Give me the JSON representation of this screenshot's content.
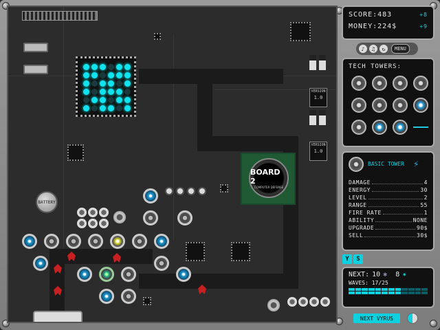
{
  "hud": {
    "score_label": "SCORE:",
    "score_value": "483",
    "score_delta": "+8",
    "money_label": "MONEY:",
    "money_value": "224$",
    "money_delta": "+9"
  },
  "toolbar": {
    "sound_icon": "speaker-icon",
    "music_icon": "music-note-icon",
    "restart_icon": "refresh-icon",
    "menu_label": "MENU"
  },
  "towers": {
    "title": "TECH TOWERS:",
    "items": [
      "tower-basic",
      "tower-drum",
      "tower-cage",
      "tower-coil",
      "tower-ring",
      "tower-cross",
      "tower-box",
      "tower-lens",
      "tower-cannon",
      "tower-blue-gear",
      "tower-blue-star",
      "tower-beam"
    ]
  },
  "info": {
    "name": "BASIC TOWER",
    "stats": [
      {
        "label": "DAMAGE",
        "value": "4"
      },
      {
        "label": "ENERGY",
        "value": "30"
      },
      {
        "label": "LEVEL",
        "value": "2"
      },
      {
        "label": "RANGE",
        "value": "55"
      },
      {
        "label": "FIRE RATE",
        "value": "1"
      },
      {
        "label": "ABILITY",
        "value": "NONE"
      },
      {
        "label": "UPGRADE",
        "value": "90$"
      },
      {
        "label": "SELL",
        "value": "30$"
      }
    ]
  },
  "buttons": {
    "y": "Y",
    "s": "S"
  },
  "wave": {
    "next_label": "NEXT:",
    "next_a": "10",
    "next_b": "8",
    "waves_label": "WAVES:",
    "waves_value": "17/25",
    "next_button": "NEXT VYRUS"
  },
  "board": {
    "cpu_title": "BOARD 2",
    "cpu_subtitle": "COMPUTER DEFENSE",
    "battery_label": "BATTERY",
    "version_label": "VERSION",
    "version_value": "1.0"
  },
  "colors": {
    "accent": "#0ed1e0",
    "enemy": "#c82020",
    "cpu": "#1f5a35"
  }
}
